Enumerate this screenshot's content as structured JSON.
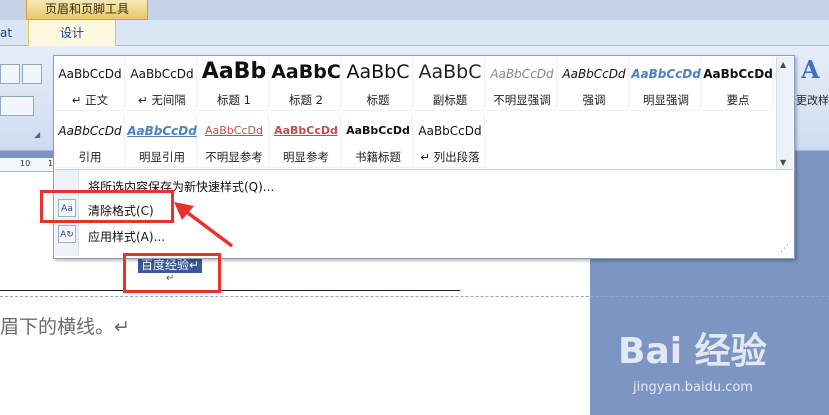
{
  "context_tab": {
    "title": "页眉和页脚工具"
  },
  "tabs": {
    "cut_left": "at",
    "design": "设计"
  },
  "ruler": {
    "ticks": [
      "10",
      "12"
    ]
  },
  "gallery": {
    "styles": [
      {
        "sample": "AaBbCcDd",
        "name": "↵ 正文"
      },
      {
        "sample": "AaBbCcDd",
        "name": "↵ 无间隔"
      },
      {
        "sample": "AaBb",
        "name": "标题 1"
      },
      {
        "sample": "AaBbC",
        "name": "标题 2"
      },
      {
        "sample": "AaBbC",
        "name": "标题"
      },
      {
        "sample": "AaBbC",
        "name": "副标题"
      },
      {
        "sample": "AaBbCcDd",
        "name": "不明显强调"
      },
      {
        "sample": "AaBbCcDd",
        "name": "强调"
      },
      {
        "sample": "AaBbCcDd",
        "name": "明显强调"
      },
      {
        "sample": "AaBbCcDd",
        "name": "要点"
      },
      {
        "sample": "AaBbCcDd",
        "name": "引用"
      },
      {
        "sample": "AaBbCcDd",
        "name": "明显引用"
      },
      {
        "sample": "AaBbCcDd",
        "name": "不明显参考"
      },
      {
        "sample": "AaBbCcDd",
        "name": "明显参考"
      },
      {
        "sample": "AaBbCcDd",
        "name": "书籍标题"
      },
      {
        "sample": "AaBbCcDd",
        "name": "↵ 列出段落"
      }
    ]
  },
  "menu": {
    "save_selection": "将所选内容保存为新快速样式(Q)...",
    "clear_formatting": "清除格式(C)",
    "apply_styles": "应用样式(A)..."
  },
  "ribbon": {
    "change_styles": "更改样"
  },
  "document": {
    "header_text": "百度经验↵",
    "header_para_mark": "↵",
    "body_text": "眉下的横线。↵"
  },
  "watermark": {
    "brand": "Bai 经验",
    "url": "jingyan.baidu.com"
  },
  "colors": {
    "annotation": "#e8322a",
    "selection": "#3a5998",
    "ribbon_bg": "#dbe6f4"
  }
}
